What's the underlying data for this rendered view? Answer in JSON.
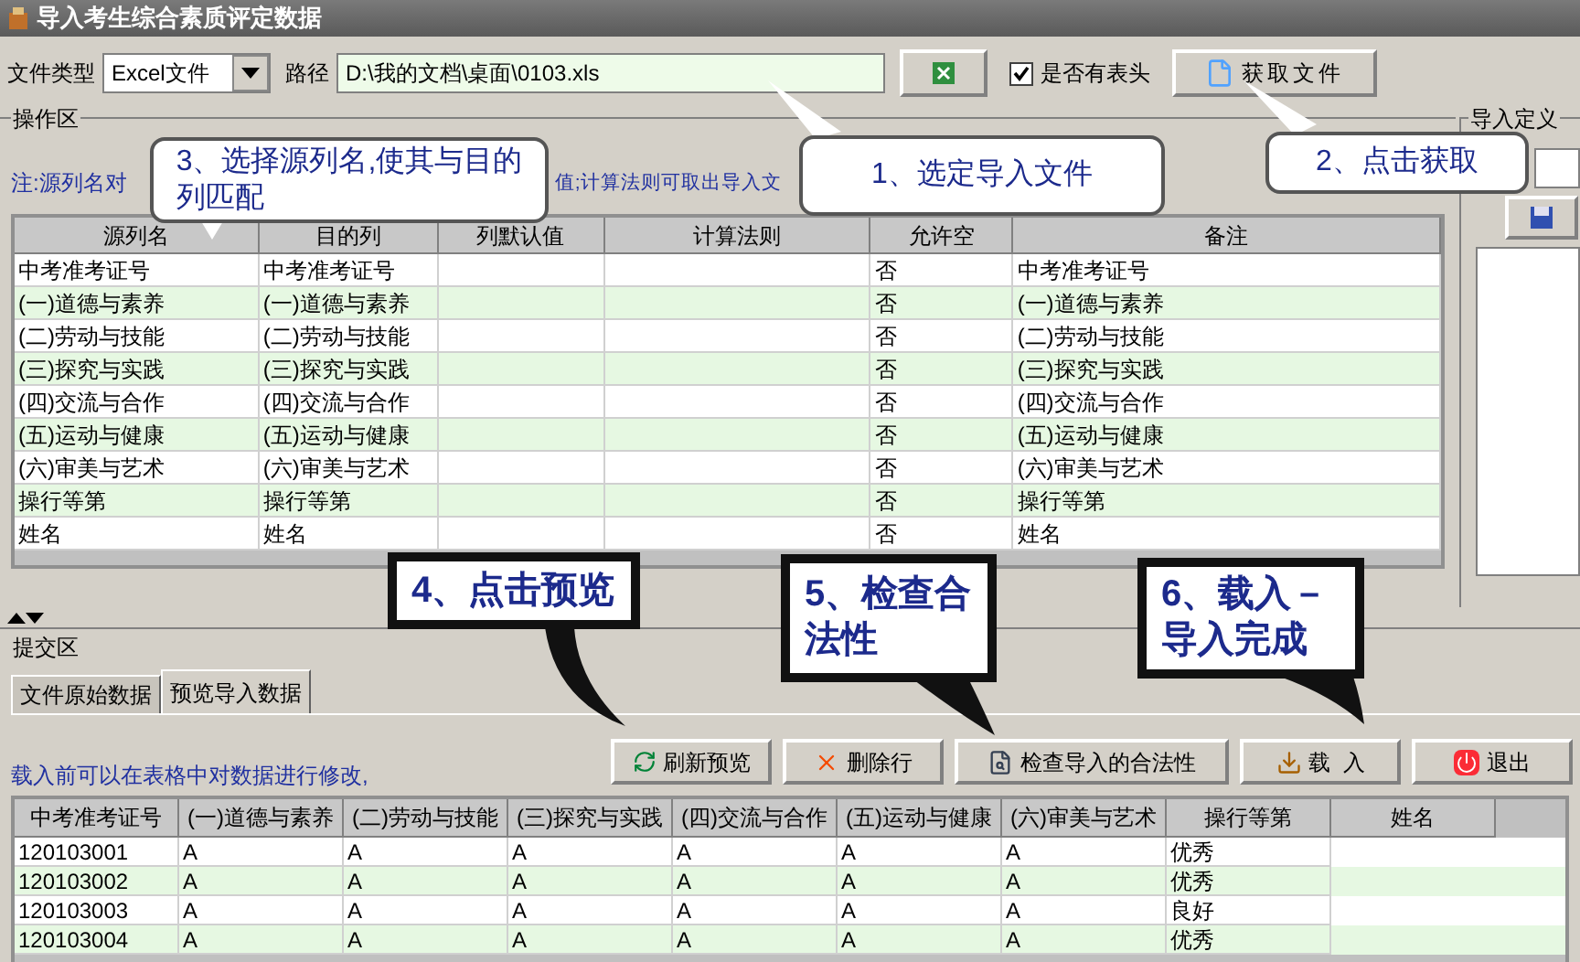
{
  "window": {
    "title": "导入考生综合素质评定数据"
  },
  "toolbar": {
    "file_type_label": "文件类型",
    "file_type_value": "Excel文件",
    "path_label": "路径",
    "path_value": "D:\\我的文档\\桌面\\0103.xls",
    "header_checkbox": {
      "label": "是否有表头",
      "checked": true
    },
    "fetch_button": "获取文件"
  },
  "operation_area": {
    "title": "操作区",
    "note_parts": [
      "注:源列名对",
      "值;计算法则可取出导入文"
    ],
    "mapping_table": {
      "columns": [
        "源列名",
        "目的列",
        "列默认值",
        "计算法则",
        "允许空",
        "备注"
      ],
      "rows": [
        [
          "中考准考证号",
          "中考准考证号",
          "",
          "",
          "否",
          "中考准考证号"
        ],
        [
          "(一)道德与素养",
          "(一)道德与素养",
          "",
          "",
          "否",
          "(一)道德与素养"
        ],
        [
          "(二)劳动与技能",
          "(二)劳动与技能",
          "",
          "",
          "否",
          "(二)劳动与技能"
        ],
        [
          "(三)探究与实践",
          "(三)探究与实践",
          "",
          "",
          "否",
          "(三)探究与实践"
        ],
        [
          "(四)交流与合作",
          "(四)交流与合作",
          "",
          "",
          "否",
          "(四)交流与合作"
        ],
        [
          "(五)运动与健康",
          "(五)运动与健康",
          "",
          "",
          "否",
          "(五)运动与健康"
        ],
        [
          "(六)审美与艺术",
          "(六)审美与艺术",
          "",
          "",
          "否",
          "(六)审美与艺术"
        ],
        [
          "操行等第",
          "操行等第",
          "",
          "",
          "否",
          "操行等第"
        ],
        [
          "姓名",
          "姓名",
          "",
          "",
          "否",
          "姓名"
        ]
      ]
    }
  },
  "import_definition": {
    "title": "导入定义"
  },
  "submit_area": {
    "title": "提交区",
    "tabs": [
      {
        "label": "文件原始数据",
        "selected": false
      },
      {
        "label": "预览导入数据",
        "selected": true
      }
    ],
    "note": "载入前可以在表格中对数据进行修改,",
    "buttons": [
      {
        "kind": "refresh",
        "label": "刷新预览"
      },
      {
        "kind": "delete",
        "label": "删除行"
      },
      {
        "kind": "check",
        "label": "检查导入的合法性"
      },
      {
        "kind": "load",
        "label": "载  入"
      },
      {
        "kind": "exit",
        "label": "退出"
      }
    ],
    "preview_table": {
      "columns": [
        "中考准考证号",
        "(一)道德与素养",
        "(二)劳动与技能",
        "(三)探究与实践",
        "(四)交流与合作",
        "(五)运动与健康",
        "(六)审美与艺术",
        "操行等第",
        "姓名"
      ],
      "rows": [
        [
          "120103001",
          "A",
          "A",
          "A",
          "A",
          "A",
          "A",
          "优秀"
        ],
        [
          "120103002",
          "A",
          "A",
          "A",
          "A",
          "A",
          "A",
          "优秀"
        ],
        [
          "120103003",
          "A",
          "A",
          "A",
          "A",
          "A",
          "A",
          "良好"
        ],
        [
          "120103004",
          "A",
          "A",
          "A",
          "A",
          "A",
          "A",
          "优秀"
        ]
      ]
    }
  },
  "callouts": [
    {
      "kind": "rounded",
      "lines": [
        "3、选择源列名,使其与目的",
        "列匹配"
      ]
    },
    {
      "kind": "rounded",
      "lines": [
        "1、选定导入文件"
      ]
    },
    {
      "kind": "rounded",
      "lines": [
        "2、点击获取"
      ]
    },
    {
      "kind": "boxed",
      "lines": [
        "4、点击预览"
      ]
    },
    {
      "kind": "boxed",
      "lines": [
        "5、检查合",
        "法性"
      ]
    },
    {
      "kind": "boxed",
      "lines": [
        "6、载入－",
        "导入完成"
      ]
    }
  ]
}
